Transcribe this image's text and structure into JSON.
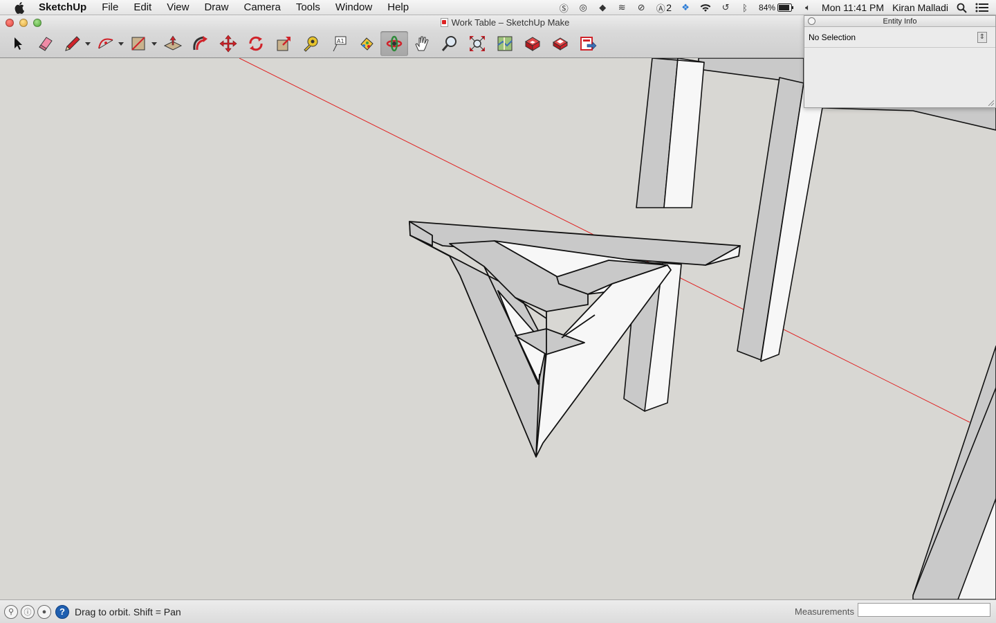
{
  "menubar": {
    "app_name": "SketchUp",
    "menus": [
      "File",
      "Edit",
      "View",
      "Draw",
      "Camera",
      "Tools",
      "Window",
      "Help"
    ],
    "status": {
      "adobe_count": "2",
      "battery": "84%",
      "clock": "Mon 11:41 PM",
      "user": "Kiran Malladi"
    }
  },
  "window": {
    "title": "Work Table – SketchUp Make"
  },
  "toolbar": {
    "tools": [
      {
        "name": "select-tool",
        "icon": "arrow-icon"
      },
      {
        "name": "eraser-tool",
        "icon": "eraser-icon"
      },
      {
        "name": "line-tool",
        "icon": "pencil-icon",
        "dropdown": true
      },
      {
        "name": "arc-tool",
        "icon": "arc-icon",
        "dropdown": true
      },
      {
        "name": "rectangle-tool",
        "icon": "rectangle-icon",
        "dropdown": true
      },
      {
        "name": "push-pull-tool",
        "icon": "push-pull-icon"
      },
      {
        "name": "offset-tool",
        "icon": "offset-icon"
      },
      {
        "name": "move-tool",
        "icon": "move-icon"
      },
      {
        "name": "rotate-tool",
        "icon": "rotate-icon"
      },
      {
        "name": "scale-tool",
        "icon": "scale-icon"
      },
      {
        "name": "tape-measure-tool",
        "icon": "tape-measure-icon"
      },
      {
        "name": "text-tool",
        "icon": "text-icon"
      },
      {
        "name": "paint-bucket-tool",
        "icon": "paint-bucket-icon"
      },
      {
        "name": "orbit-tool",
        "icon": "orbit-icon",
        "active": true
      },
      {
        "name": "pan-tool",
        "icon": "hand-icon"
      },
      {
        "name": "zoom-tool",
        "icon": "magnifier-icon"
      },
      {
        "name": "zoom-extents-tool",
        "icon": "zoom-extents-icon"
      },
      {
        "name": "3d-warehouse-tool",
        "icon": "map-icon"
      },
      {
        "name": "get-models-tool",
        "icon": "warehouse-icon"
      },
      {
        "name": "share-model-tool",
        "icon": "share-model-icon"
      },
      {
        "name": "extension-warehouse-tool",
        "icon": "extension-icon"
      }
    ],
    "accent_red": "#d0232a"
  },
  "entity_info": {
    "title": "Entity Info",
    "selection": "No Selection"
  },
  "statusbar": {
    "hint": "Drag to orbit.  Shift = Pan",
    "measurements_label": "Measurements",
    "measurements_value": ""
  },
  "viewport": {
    "background": "#d8d7d3",
    "axis_color": "#e02020"
  }
}
